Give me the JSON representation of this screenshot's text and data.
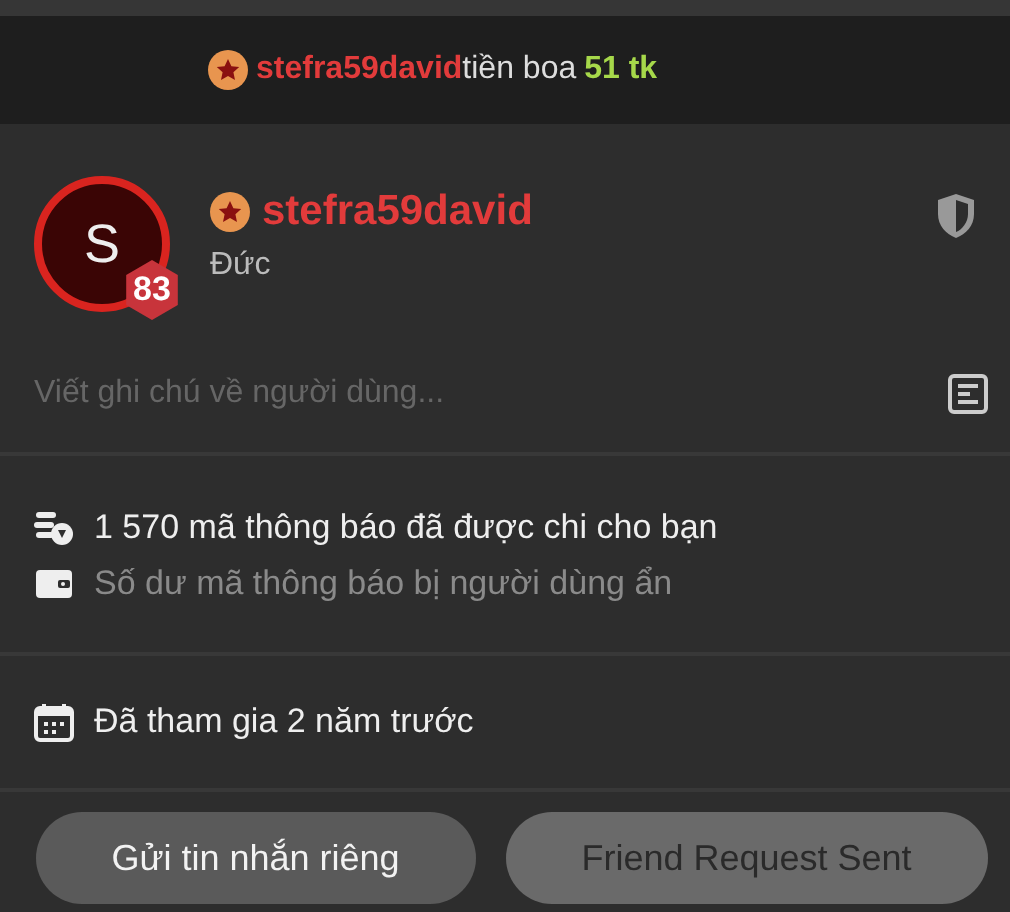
{
  "tip_banner": {
    "username": "stefra59david",
    "text": "tiền boa",
    "amount": "51 tk"
  },
  "profile": {
    "avatar_letter": "S",
    "level": "83",
    "username": "stefra59david",
    "subtitle": "Đức"
  },
  "note": {
    "placeholder": "Viết ghi chú về người dùng..."
  },
  "stats": [
    {
      "kind": "coins",
      "text": "1 570 mã thông báo đã được chi cho bạn",
      "muted": false
    },
    {
      "kind": "wallet",
      "text": "Số dư mã thông báo bị người dùng ẩn",
      "muted": true
    }
  ],
  "joined": {
    "text": "Đã tham gia 2 năm trước"
  },
  "buttons": [
    {
      "label": "Gửi tin nhắn riêng",
      "disabled": false
    },
    {
      "label": "Friend Request Sent",
      "disabled": true
    }
  ]
}
